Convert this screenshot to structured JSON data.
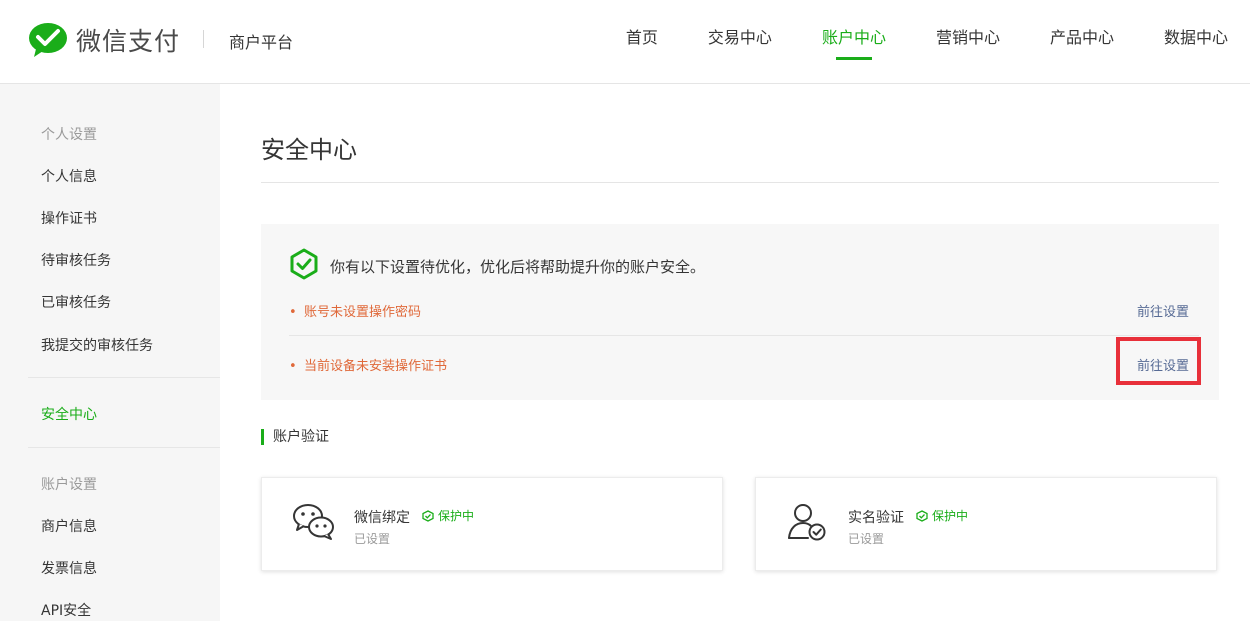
{
  "header": {
    "brand": "微信支付",
    "platform": "商户平台",
    "nav": [
      "首页",
      "交易中心",
      "账户中心",
      "营销中心",
      "产品中心",
      "数据中心"
    ],
    "active_nav": "账户中心",
    "accent_color": "#1aad19"
  },
  "sidebar": {
    "groups": {
      "personal": "个人设置",
      "account": "账户设置"
    },
    "personal_items": [
      "个人信息",
      "操作证书",
      "待审核任务",
      "已审核任务",
      "我提交的审核任务"
    ],
    "security": "安全中心",
    "account_items": [
      "商户信息",
      "发票信息",
      "API安全"
    ]
  },
  "main": {
    "title": "安全中心",
    "notice": {
      "text": "你有以下设置待优化，优化后将帮助提升你的账户安全。",
      "warnings": [
        {
          "text": "账号未设置操作密码",
          "action": "前往设置"
        },
        {
          "text": "当前设备未安装操作证书",
          "action": "前往设置"
        }
      ],
      "warn_color": "#e0693a",
      "link_color": "#576b95"
    },
    "section_title": "账户验证",
    "cards": [
      {
        "name": "微信绑定",
        "badge": "保护中",
        "status": "已设置",
        "icon": "wechat-icon"
      },
      {
        "name": "实名验证",
        "badge": "保护中",
        "status": "已设置",
        "icon": "user-verified-icon"
      }
    ]
  }
}
